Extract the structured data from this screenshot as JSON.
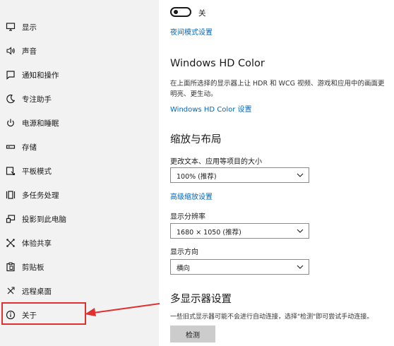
{
  "sidebar": {
    "items": [
      {
        "label": "显示",
        "icon": "monitor-icon"
      },
      {
        "label": "声音",
        "icon": "speaker-icon"
      },
      {
        "label": "通知和操作",
        "icon": "message-icon"
      },
      {
        "label": "专注助手",
        "icon": "moon-icon"
      },
      {
        "label": "电源和睡眠",
        "icon": "power-icon"
      },
      {
        "label": "存储",
        "icon": "storage-icon"
      },
      {
        "label": "平板模式",
        "icon": "tablet-icon"
      },
      {
        "label": "多任务处理",
        "icon": "multitask-icon"
      },
      {
        "label": "投影到此电脑",
        "icon": "project-icon"
      },
      {
        "label": "体验共享",
        "icon": "share-icon"
      },
      {
        "label": "剪贴板",
        "icon": "clipboard-icon"
      },
      {
        "label": "远程桌面",
        "icon": "remote-icon"
      },
      {
        "label": "关于",
        "icon": "info-icon"
      }
    ]
  },
  "night_light": {
    "toggle_state": "关",
    "settings_link": "夜间模式设置"
  },
  "hd_color": {
    "title": "Windows HD Color",
    "description_line1": "在上面所选择的显示器上让 HDR 和 WCG 视频、游戏和应用中的画面更",
    "description_line2": "明亮、更生动。",
    "settings_link": "Windows HD Color 设置"
  },
  "scale_layout": {
    "title": "缩放与布局",
    "scale_label": "更改文本、应用等项目的大小",
    "scale_value": "100% (推荐)",
    "advanced_link": "高级缩放设置",
    "resolution_label": "显示分辨率",
    "resolution_value": "1680 × 1050 (推荐)",
    "orientation_label": "显示方向",
    "orientation_value": "横向"
  },
  "multi_display": {
    "title": "多显示器设置",
    "description": "一些旧式显示器可能不会进行自动连接，选择\"检测\"即可尝试手动连接。",
    "detect_button": "检测"
  },
  "annotation_color": "#e03030"
}
